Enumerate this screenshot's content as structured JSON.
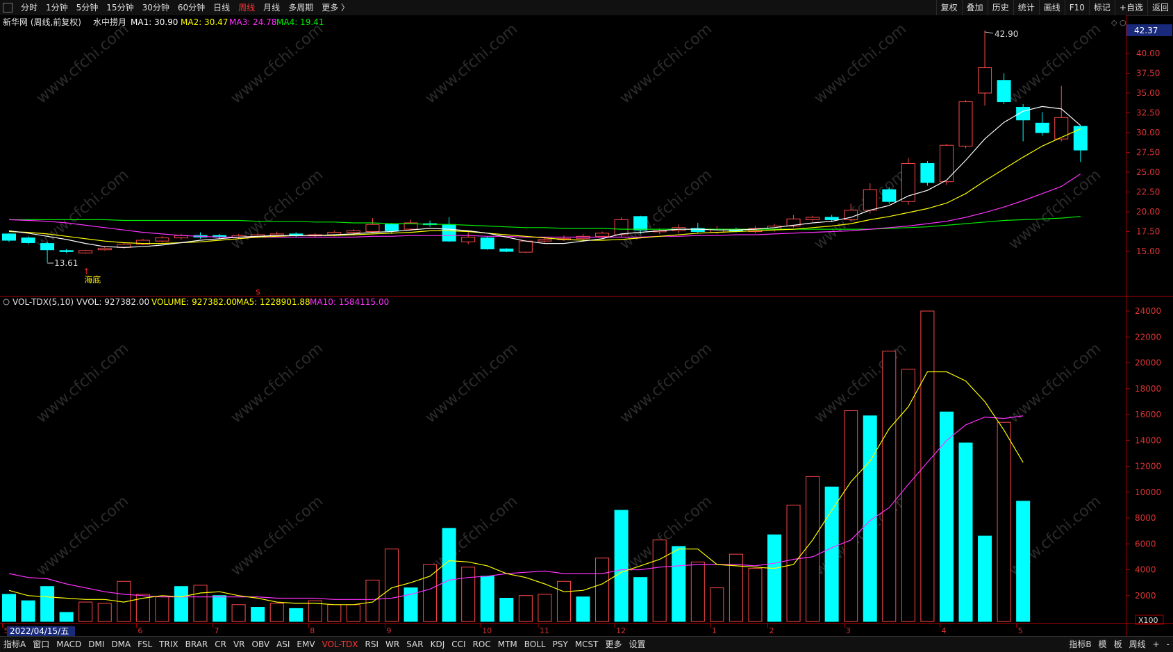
{
  "toolbar": {
    "tabs": [
      "分时",
      "1分钟",
      "5分钟",
      "15分钟",
      "30分钟",
      "60分钟",
      "日线",
      "周线",
      "月线",
      "多周期",
      "更多 〉"
    ],
    "active_tab": "周线",
    "right_buttons": [
      "复权",
      "叠加",
      "历史",
      "统计",
      "画线",
      "F10",
      "标记",
      "+自选",
      "返回"
    ]
  },
  "main_legend": {
    "stock": "新华网 (周线,前复权)",
    "indicator": "水中捞月",
    "ma1": "MA1: 30.90",
    "ma2": "MA2: 30.47",
    "ma3": "MA3: 24.78",
    "ma4": "MA4: 19.41",
    "current_price": "42.37"
  },
  "vol_legend": {
    "name": "VOL-TDX(5,10)",
    "vvol": "VVOL: 927382.00",
    "volume": "VOLUME: 927382.00",
    "ma5": "MA5: 1228901.88",
    "ma10": "MA10: 1584115.00"
  },
  "annotations": {
    "high_label": "42.90",
    "low_label": "13.61",
    "bottom_signal": "海底",
    "date_label": "2022/04/15/五",
    "vol_unit": "X100"
  },
  "indicator_tabs": [
    "MACD",
    "DMI",
    "DMA",
    "FSL",
    "TRIX",
    "BRAR",
    "CR",
    "VR",
    "OBV",
    "ASI",
    "EMV",
    "VOL-TDX",
    "RSI",
    "WR",
    "SAR",
    "KDJ",
    "CCI",
    "ROC",
    "MTM",
    "BOLL",
    "PSY",
    "MCST",
    "更多",
    "设置"
  ],
  "indicator_active": "VOL-TDX",
  "bottom_left_label": "指标A",
  "bottom_window": "窗口",
  "bottom_right": [
    "指标B",
    "模",
    "板",
    "周线",
    "+",
    "-"
  ],
  "colors": {
    "up": "#ff4a4a",
    "down": "#00ffff",
    "ma1": "#ffffff",
    "ma2": "#ffff00",
    "ma3": "#ff33ff",
    "ma4": "#00ee00"
  },
  "chart_data": [
    {
      "type": "candlestick",
      "title": "新华网 (周线,前复权)",
      "ylim": [
        12.5,
        42.9
      ],
      "y_ticks": [
        15.0,
        17.5,
        20.0,
        22.5,
        25.0,
        27.5,
        30.0,
        32.5,
        35.0,
        37.5,
        40.0
      ],
      "x_month_labels": [
        "5",
        "6",
        "7",
        "8",
        "9",
        "10",
        "11",
        "12",
        "1",
        "2",
        "3",
        "4",
        "5"
      ],
      "x_month_index": [
        0,
        7,
        11,
        16,
        20,
        25,
        28,
        32,
        37,
        40,
        44,
        49,
        53
      ],
      "candles": [
        [
          17.2,
          16.4,
          17.3,
          16.2
        ],
        [
          16.7,
          16.1,
          16.9,
          15.9
        ],
        [
          16.0,
          15.2,
          16.2,
          13.6
        ],
        [
          15.1,
          15.0,
          15.3,
          14.8
        ],
        [
          14.8,
          15.1,
          15.2,
          14.7
        ],
        [
          15.2,
          15.4,
          15.6,
          15.1
        ],
        [
          15.5,
          15.9,
          16.1,
          15.3
        ],
        [
          15.9,
          16.4,
          16.6,
          15.8
        ],
        [
          16.3,
          16.7,
          16.9,
          16.1
        ],
        [
          16.7,
          17.0,
          17.2,
          16.5
        ],
        [
          17.0,
          16.8,
          17.4,
          16.6
        ],
        [
          17.0,
          16.8,
          17.2,
          16.6
        ],
        [
          16.8,
          17.0,
          17.2,
          16.6
        ],
        [
          16.9,
          17.1,
          17.4,
          16.7
        ],
        [
          17.0,
          17.2,
          17.5,
          16.8
        ],
        [
          17.2,
          17.0,
          17.4,
          16.8
        ],
        [
          17.0,
          17.1,
          17.3,
          16.8
        ],
        [
          17.1,
          17.4,
          17.6,
          16.9
        ],
        [
          17.4,
          17.6,
          17.8,
          17.1
        ],
        [
          17.5,
          18.4,
          19.2,
          17.3
        ],
        [
          18.4,
          17.6,
          18.6,
          17.2
        ],
        [
          17.8,
          18.6,
          19.0,
          17.6
        ],
        [
          18.5,
          18.4,
          18.9,
          18.1
        ],
        [
          18.4,
          16.3,
          19.3,
          16.2
        ],
        [
          16.2,
          16.8,
          17.4,
          15.9
        ],
        [
          16.7,
          15.3,
          16.9,
          15.2
        ],
        [
          15.3,
          15.0,
          15.4,
          14.9
        ],
        [
          14.9,
          16.3,
          16.4,
          14.8
        ],
        [
          16.3,
          16.5,
          16.8,
          16.1
        ],
        [
          16.5,
          16.6,
          17.0,
          16.3
        ],
        [
          16.6,
          16.9,
          17.2,
          16.4
        ],
        [
          16.9,
          17.3,
          17.5,
          16.7
        ],
        [
          17.1,
          19.0,
          19.3,
          16.8
        ],
        [
          19.4,
          17.7,
          19.5,
          17.2
        ],
        [
          17.5,
          17.6,
          17.9,
          17.2
        ],
        [
          17.6,
          18.0,
          18.4,
          17.3
        ],
        [
          17.9,
          17.5,
          18.6,
          17.3
        ],
        [
          17.4,
          17.8,
          18.2,
          17.2
        ],
        [
          17.7,
          17.6,
          18.0,
          17.4
        ],
        [
          17.5,
          17.9,
          18.2,
          17.3
        ],
        [
          17.8,
          18.2,
          18.5,
          17.5
        ],
        [
          18.2,
          19.1,
          19.6,
          18.0
        ],
        [
          19.0,
          19.3,
          19.5,
          18.8
        ],
        [
          19.3,
          19.0,
          19.6,
          18.7
        ],
        [
          19.0,
          20.2,
          21.0,
          18.8
        ],
        [
          20.2,
          22.8,
          23.6,
          19.8
        ],
        [
          22.8,
          21.3,
          23.1,
          21.0
        ],
        [
          21.3,
          26.1,
          26.8,
          20.9
        ],
        [
          26.1,
          23.7,
          26.4,
          23.3
        ],
        [
          23.8,
          28.4,
          28.6,
          23.4
        ],
        [
          28.3,
          33.9,
          34.1,
          28.0
        ],
        [
          35.0,
          38.2,
          42.9,
          33.4
        ],
        [
          36.6,
          33.9,
          37.5,
          33.6
        ],
        [
          33.2,
          31.6,
          33.6,
          28.9
        ],
        [
          31.2,
          30.0,
          32.6,
          29.6
        ],
        [
          29.2,
          31.9,
          35.9,
          28.9
        ],
        [
          30.8,
          27.8,
          30.9,
          26.3
        ]
      ],
      "ma1": [
        17.6,
        17.3,
        16.9,
        16.5,
        16.0,
        15.6,
        15.5,
        15.6,
        15.8,
        16.1,
        16.4,
        16.6,
        16.8,
        16.9,
        17.0,
        17.0,
        17.0,
        17.1,
        17.2,
        17.4,
        17.5,
        17.7,
        17.9,
        17.8,
        17.6,
        17.3,
        16.8,
        16.3,
        16.0,
        16.0,
        16.3,
        16.6,
        17.2,
        17.4,
        17.6,
        17.8,
        17.8,
        17.7,
        17.7,
        17.8,
        18.0,
        18.3,
        18.6,
        18.8,
        19.3,
        20.2,
        20.8,
        22.0,
        22.7,
        24.0,
        26.5,
        29.2,
        31.3,
        32.7,
        33.3,
        33.0,
        30.9
      ],
      "ma2": [
        17.5,
        17.4,
        17.2,
        16.9,
        16.6,
        16.3,
        16.1,
        16.0,
        16.0,
        16.1,
        16.2,
        16.4,
        16.6,
        16.8,
        16.9,
        17.0,
        17.0,
        17.0,
        17.1,
        17.2,
        17.3,
        17.4,
        17.6,
        17.6,
        17.5,
        17.3,
        17.1,
        16.9,
        16.7,
        16.5,
        16.4,
        16.4,
        16.5,
        16.7,
        16.9,
        17.1,
        17.3,
        17.4,
        17.5,
        17.6,
        17.7,
        17.8,
        18.0,
        18.2,
        18.5,
        19.0,
        19.4,
        19.9,
        20.4,
        21.1,
        22.3,
        23.9,
        25.4,
        26.9,
        28.3,
        29.4,
        30.47
      ],
      "ma3": [
        19.0,
        18.9,
        18.8,
        18.6,
        18.3,
        18.0,
        17.7,
        17.4,
        17.2,
        17.0,
        16.9,
        16.8,
        16.8,
        16.8,
        16.8,
        16.8,
        16.8,
        16.8,
        16.8,
        16.9,
        16.9,
        17.0,
        17.0,
        17.0,
        17.0,
        16.9,
        16.9,
        16.8,
        16.8,
        16.8,
        16.8,
        16.8,
        16.8,
        16.8,
        16.9,
        16.9,
        17.0,
        17.0,
        17.1,
        17.1,
        17.2,
        17.3,
        17.4,
        17.5,
        17.6,
        17.8,
        18.0,
        18.2,
        18.5,
        18.8,
        19.3,
        19.9,
        20.6,
        21.4,
        22.3,
        23.2,
        24.78
      ],
      "ma4": [
        19.0,
        19.0,
        19.0,
        19.0,
        19.0,
        19.0,
        18.9,
        18.9,
        18.9,
        18.9,
        18.9,
        18.9,
        18.9,
        18.8,
        18.8,
        18.8,
        18.7,
        18.7,
        18.6,
        18.6,
        18.5,
        18.5,
        18.4,
        18.4,
        18.3,
        18.2,
        18.1,
        18.0,
        18.0,
        17.9,
        17.9,
        17.9,
        17.8,
        17.8,
        17.8,
        17.8,
        17.8,
        17.8,
        17.8,
        17.8,
        17.8,
        17.8,
        17.8,
        17.8,
        17.8,
        17.8,
        17.9,
        18.0,
        18.1,
        18.3,
        18.5,
        18.7,
        18.9,
        19.0,
        19.1,
        19.2,
        19.41
      ]
    },
    {
      "type": "bar",
      "title": "VOL-TDX(5,10)",
      "ylim": [
        0,
        24000
      ],
      "y_ticks": [
        2000,
        4000,
        6000,
        8000,
        10000,
        12000,
        14000,
        16000,
        18000,
        20000,
        22000,
        24000
      ],
      "unit": "X100",
      "volumes": [
        2100,
        1600,
        2700,
        700,
        1500,
        1400,
        3100,
        2100,
        1900,
        2700,
        2800,
        2000,
        1300,
        1100,
        1400,
        1000,
        1600,
        1300,
        1300,
        3200,
        5600,
        2600,
        4400,
        7200,
        4200,
        3500,
        1800,
        2000,
        2100,
        3100,
        1900,
        4900,
        8600,
        3400,
        6300,
        5800,
        4600,
        2600,
        5200,
        4100,
        6700,
        9000,
        11200,
        10400,
        16300,
        15900,
        20900,
        19500,
        24000,
        16200,
        13800,
        6600,
        15400,
        9300
      ],
      "vol_up": [
        0,
        0,
        0,
        0,
        1,
        1,
        1,
        1,
        1,
        0,
        1,
        0,
        1,
        0,
        1,
        0,
        1,
        1,
        1,
        1,
        1,
        0,
        1,
        0,
        1,
        0,
        0,
        1,
        1,
        1,
        0,
        1,
        0,
        0,
        1,
        0,
        1,
        1,
        1,
        1,
        0,
        1,
        1,
        0,
        1,
        0,
        1,
        1,
        1,
        0,
        0,
        0,
        1,
        0
      ],
      "ma5": [
        2400,
        2000,
        1900,
        1800,
        1700,
        1700,
        1500,
        1800,
        2000,
        1900,
        2200,
        2300,
        2000,
        1800,
        1500,
        1400,
        1400,
        1300,
        1300,
        1500,
        2600,
        3000,
        3500,
        4700,
        4600,
        4300,
        3700,
        3400,
        2900,
        2300,
        2400,
        2900,
        3800,
        4300,
        4800,
        5600,
        5600,
        4400,
        4300,
        4200,
        4100,
        4400,
        6300,
        8600,
        10800,
        12400,
        14900,
        16600,
        19300,
        19300,
        18600,
        17000,
        14800,
        12300
      ],
      "ma10": [
        3700,
        3400,
        3300,
        2900,
        2600,
        2300,
        2100,
        2000,
        1900,
        1900,
        1900,
        1900,
        1900,
        1900,
        1800,
        1800,
        1800,
        1700,
        1700,
        1700,
        1800,
        2100,
        2500,
        3200,
        3400,
        3500,
        3700,
        3800,
        3900,
        3700,
        3700,
        3700,
        4000,
        4000,
        4200,
        4300,
        4400,
        4400,
        4400,
        4300,
        4500,
        4800,
        5000,
        5700,
        6300,
        7800,
        8800,
        10600,
        12300,
        14000,
        15200,
        15800,
        15700,
        15900
      ]
    }
  ]
}
